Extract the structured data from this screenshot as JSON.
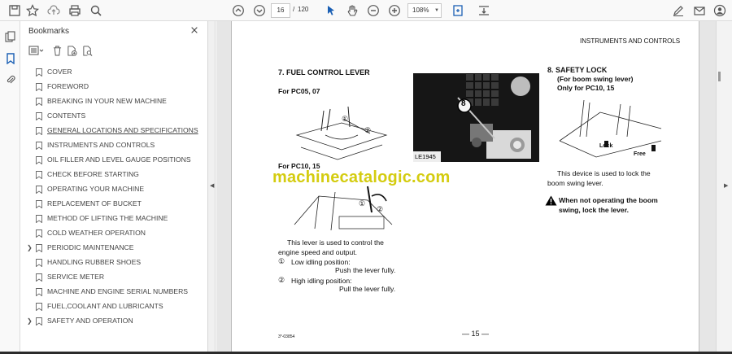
{
  "toolbar": {
    "current_page": "16",
    "page_separator": "/",
    "total_pages": "120",
    "zoom": "108%"
  },
  "bookmarks_panel": {
    "title": "Bookmarks",
    "items": [
      {
        "label": "COVER",
        "expandable": false,
        "current": false
      },
      {
        "label": "FOREWORD",
        "expandable": false,
        "current": false
      },
      {
        "label": "BREAKING IN YOUR NEW MACHINE",
        "expandable": false,
        "current": false
      },
      {
        "label": "CONTENTS",
        "expandable": false,
        "current": false
      },
      {
        "label": "GENERAL LOCATIONS AND SPECIFICATIONS",
        "expandable": false,
        "current": true
      },
      {
        "label": "INSTRUMENTS AND CONTROLS",
        "expandable": false,
        "current": false
      },
      {
        "label": "OIL FILLER AND LEVEL GAUGE POSITIONS",
        "expandable": false,
        "current": false
      },
      {
        "label": "CHECK BEFORE STARTING",
        "expandable": false,
        "current": false
      },
      {
        "label": "OPERATING YOUR MACHINE",
        "expandable": false,
        "current": false
      },
      {
        "label": "REPLACEMENT OF BUCKET",
        "expandable": false,
        "current": false
      },
      {
        "label": "METHOD OF LIFTING THE MACHINE",
        "expandable": false,
        "current": false
      },
      {
        "label": "COLD WEATHER OPERATION",
        "expandable": false,
        "current": false
      },
      {
        "label": "PERIODIC MAINTENANCE",
        "expandable": true,
        "current": false
      },
      {
        "label": "HANDLING RUBBER SHOES",
        "expandable": false,
        "current": false
      },
      {
        "label": "SERVICE METER",
        "expandable": false,
        "current": false
      },
      {
        "label": "MACHINE AND ENGINE SERIAL NUMBERS",
        "expandable": false,
        "current": false
      },
      {
        "label": "FUEL,COOLANT AND LUBRICANTS",
        "expandable": false,
        "current": false
      },
      {
        "label": "SAFETY AND OPERATION",
        "expandable": true,
        "current": false
      }
    ]
  },
  "document": {
    "header": "INSTRUMENTS AND CONTROLS",
    "section7_title": "7.  FUEL CONTROL LEVER",
    "for_pc05": "For PC05, 07",
    "for_pc10": "For PC10, 15",
    "photo_label": "LE1945",
    "photo_callout": "8",
    "fig1_callout1": "①",
    "fig1_callout2": "②",
    "fig2_callout1": "①",
    "fig2_callout2": "②",
    "lever_desc_line1": "This lever is used to control the",
    "lever_desc_line2": "engine speed and output.",
    "low_idle_num": "①",
    "low_idle_label": "Low idling position:",
    "low_idle_action": "Push the lever fully.",
    "high_idle_num": "②",
    "high_idle_label": "High idling position:",
    "high_idle_action": "Pull the lever fully.",
    "section8_title": "8.  SAFETY LOCK",
    "section8_sub1": "(For boom swing lever)",
    "section8_sub2": "Only for PC10, 15",
    "lock_label": "Lock",
    "free_label": "Free",
    "safety_desc_line1": "This  device  is  used  to  lock  the",
    "safety_desc_line2": "boom swing lever.",
    "warning_line1": "When  not  operating  the  boom",
    "warning_line2": "swing, lock the lever.",
    "page_number": "— 15 —",
    "footer_code": "3*-03854",
    "watermark": "machinecatalogic.com"
  },
  "colors": {
    "watermark": "#d4cc10",
    "accent_blue": "#1a5fb4"
  }
}
